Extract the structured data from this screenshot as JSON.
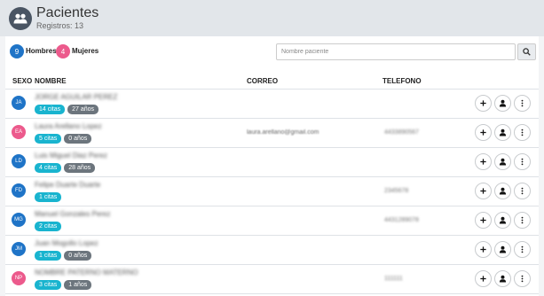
{
  "header": {
    "title": "Pacientes",
    "subtitle": "Registros: 13",
    "icon": "users-icon"
  },
  "summary": {
    "men_count": "9",
    "men_label": "Hombres",
    "women_count": "4",
    "women_label": "Mujeres"
  },
  "search": {
    "placeholder": "Nombre paciente",
    "button_icon": "search-icon"
  },
  "table": {
    "columns": {
      "sexo": "SEXO",
      "nombre": "NOMBRE",
      "correo": "CORREO",
      "telefono": "TELEFONO"
    },
    "rows": [
      {
        "initials": "JA",
        "sex": "M",
        "name": "JORGE AGUILAR PEREZ",
        "citas": "14 citas",
        "age": "27 años",
        "email": "",
        "phone": ""
      },
      {
        "initials": "EA",
        "sex": "F",
        "name": "Laura Arellano Lopez",
        "citas": "5 citas",
        "age": "0 años",
        "email": "laura.arellano@gmail.com",
        "phone": "4433890567"
      },
      {
        "initials": "LD",
        "sex": "M",
        "name": "Luis Miguel Diaz Perez",
        "citas": "4 citas",
        "age": "28 años",
        "email": "",
        "phone": ""
      },
      {
        "initials": "FD",
        "sex": "M",
        "name": "Felipe Duarte Duarte",
        "citas": "1 citas",
        "age": "",
        "email": "",
        "phone": "2345678"
      },
      {
        "initials": "MG",
        "sex": "M",
        "name": "Manuel Gonzales Perez",
        "citas": "2 citas",
        "age": "",
        "email": "",
        "phone": "4431289078"
      },
      {
        "initials": "JM",
        "sex": "M",
        "name": "Juan Mogollo Lopez",
        "citas": "1 citas",
        "age": "0 años",
        "email": "",
        "phone": ""
      },
      {
        "initials": "NP",
        "sex": "F",
        "name": "NOMBRE PATERNO MATERNO",
        "citas": "3 citas",
        "age": "1 años",
        "email": "",
        "phone": "111111"
      }
    ]
  },
  "actions": {
    "add_icon": "plus-icon",
    "profile_icon": "person-icon",
    "more_icon": "more-vertical-icon"
  },
  "colors": {
    "male": "#1f74c7",
    "female": "#ec5a8c",
    "citas": "#19b4cf",
    "age": "#6c757d"
  }
}
